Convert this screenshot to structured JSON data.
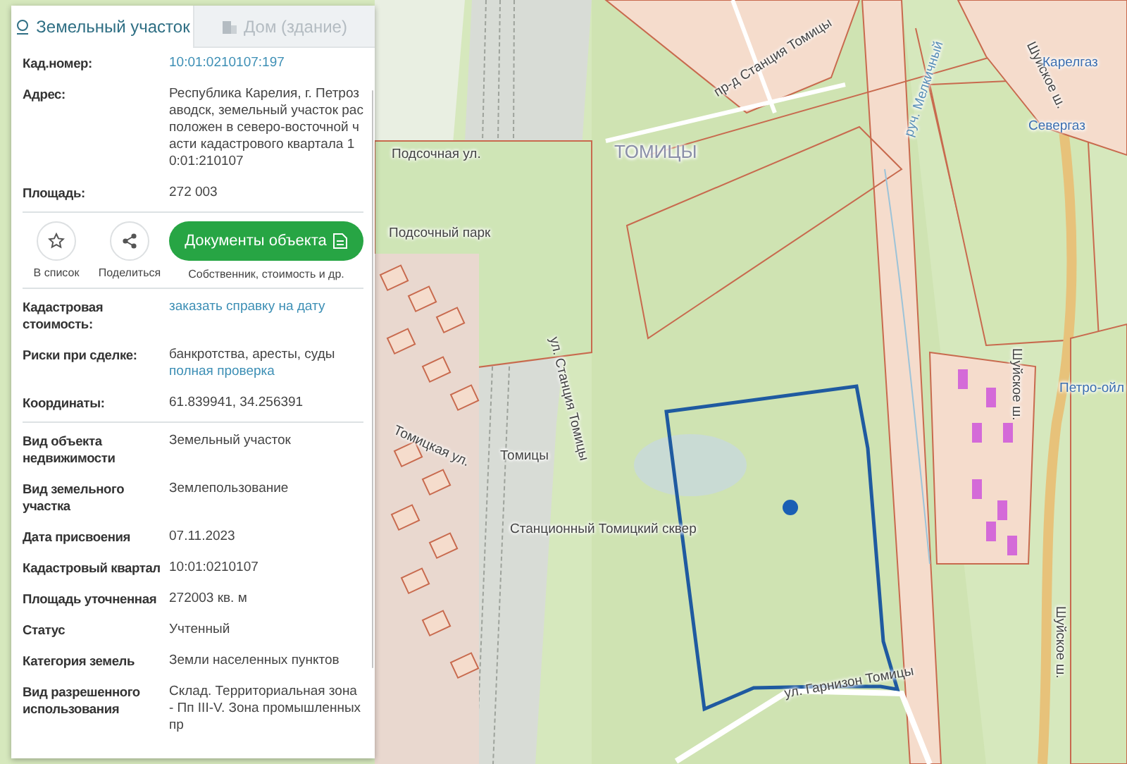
{
  "tabs": [
    {
      "label": "Земельный участок",
      "selected": true
    },
    {
      "label": "Дом (здание)",
      "selected": false
    }
  ],
  "summary": [
    {
      "label": "Кад.номер:",
      "value": "10:01:0210107:197",
      "kind": "link"
    },
    {
      "label": "Адрес:",
      "value": "Республика Карелия, г. Петрозаводск, земельный участок расположен в северо-восточной части кадастрового квартала 10:01:210107",
      "kind": "text"
    },
    {
      "label": "Площадь:",
      "value": "272 003",
      "kind": "text"
    }
  ],
  "actions": [
    {
      "label": "В список",
      "kind": "star"
    },
    {
      "label": "Поделиться",
      "kind": "share"
    }
  ],
  "documents": {
    "label": "Документы объекта",
    "caption": "Собственник, стоимость и др."
  },
  "checks": [
    {
      "label": "Кадастровая стоимость:",
      "link": "заказать справку на дату"
    },
    {
      "label": "Риски при сделке:",
      "value": "банкротства, аресты, суды",
      "link": "полная проверка"
    },
    {
      "label": "Координаты:",
      "value": "61.839941, 34.256391"
    }
  ],
  "details": [
    {
      "label": "Вид объекта недвижимости",
      "value": "Земельный участок"
    },
    {
      "label": "Вид земельного участка",
      "value": "Землепользование"
    },
    {
      "label": "Дата присвоения",
      "value": "07.11.2023"
    },
    {
      "label": "Кадастровый квартал",
      "value": "10:01:0210107"
    },
    {
      "label": "Площадь уточненная",
      "value": "272003 кв. м"
    },
    {
      "label": "Статус",
      "value": "Учтенный"
    },
    {
      "label": "Категория земель",
      "value": "Земли населенных пунктов"
    },
    {
      "label": "Вид разрешенного использования",
      "value": "Склад. Территориальная зона - Пп III-V. Зона промышленных пр"
    }
  ],
  "map_labels": [
    {
      "text": "Подсочная ул.",
      "kind": "street"
    },
    {
      "text": "ТОМИЦЫ",
      "kind": "place"
    },
    {
      "text": "пр-д Станция Томицы",
      "kind": "street"
    },
    {
      "text": "руч. Мелкичный",
      "kind": "water"
    },
    {
      "text": "Шуйское ш.",
      "kind": "street"
    },
    {
      "text": "Карелгаз",
      "kind": "poi"
    },
    {
      "text": "Севергаз",
      "kind": "poi"
    },
    {
      "text": "Подсочный парк",
      "kind": "park"
    },
    {
      "text": "ул. Станция Томицы",
      "kind": "street"
    },
    {
      "text": "Шуйское ш.",
      "kind": "street"
    },
    {
      "text": "Петро-ойл",
      "kind": "poi"
    },
    {
      "text": "Томицкая ул.",
      "kind": "street"
    },
    {
      "text": "Томицы",
      "kind": "station"
    },
    {
      "text": "Станционный Томицкий сквер",
      "kind": "park"
    },
    {
      "text": "Шуйское ш.",
      "kind": "street"
    },
    {
      "text": "ул. Гарнизон Томицы",
      "kind": "street"
    }
  ]
}
